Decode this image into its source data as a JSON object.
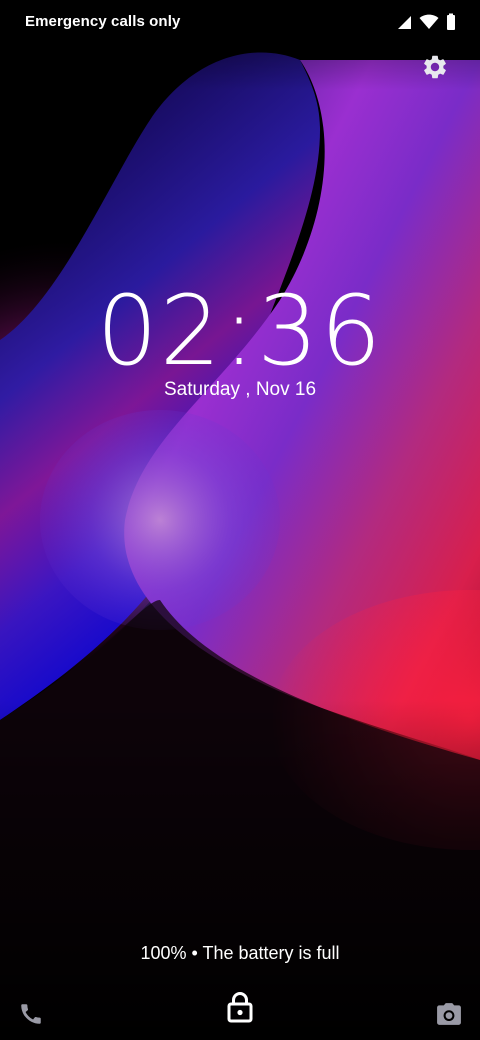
{
  "status_bar": {
    "carrier_text": "Emergency calls only",
    "icons": [
      "signal-icon",
      "wifi-icon",
      "battery-icon"
    ]
  },
  "lockscreen": {
    "clock": "02:36",
    "date": "Saturday , Nov 16",
    "battery_message": "100% • The battery is full"
  },
  "shortcuts": {
    "left": "phone-icon",
    "center": "lock-icon",
    "right": "camera-icon"
  },
  "colors": {
    "background": "#000000",
    "text": "#ffffff",
    "wallpaper_blue": "#2a1ad6",
    "wallpaper_purple": "#8a2bc8",
    "wallpaper_magenta": "#b0128c",
    "wallpaper_red": "#e01d4a"
  }
}
